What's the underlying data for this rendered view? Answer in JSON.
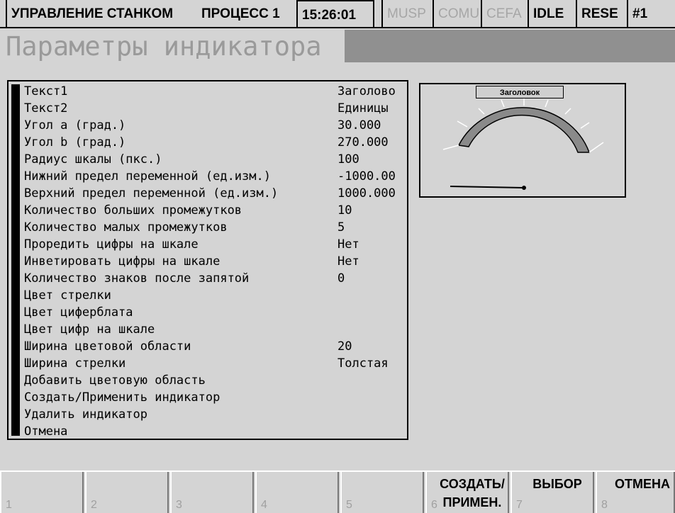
{
  "status_bar": {
    "machine_control": "УПРАВЛЕНИЕ СТАНКОМ",
    "process": "ПРОЦЕСС 1",
    "time": "15:26:01",
    "musp": "MUSP",
    "comu": "COMU",
    "cefa": "CEFA",
    "idle": "IDLE",
    "rese": "RESE",
    "channel": "#1"
  },
  "page_title": "Параметры индикатора",
  "params": [
    {
      "label": "Текст1",
      "value": "Заголово"
    },
    {
      "label": "Текст2",
      "value": "Единицы"
    },
    {
      "label": "Угол a (град.)",
      "value": "30.000"
    },
    {
      "label": "Угол b (град.)",
      "value": "270.000"
    },
    {
      "label": "Радиус шкалы (пкс.)",
      "value": "100"
    },
    {
      "label": "Нижний предел переменной (ед.изм.)",
      "value": "-1000.00"
    },
    {
      "label": "Верхний предел переменной (ед.изм.)",
      "value": "1000.000"
    },
    {
      "label": "Количество больших промежутков",
      "value": "10"
    },
    {
      "label": "Количество малых промежутков",
      "value": "5"
    },
    {
      "label": "Проредить цифры на шкале",
      "value": "Нет"
    },
    {
      "label": "Инветировать цифры на шкале",
      "value": "Нет"
    },
    {
      "label": "Количество знаков после запятой",
      "value": "0"
    },
    {
      "label": "Цвет стрелки",
      "swatch_color": "#000000"
    },
    {
      "label": "Цвет циферблата",
      "swatch_color": "#000000"
    },
    {
      "label": "Цвет цифр на шкале",
      "swatch_color": "#000000"
    },
    {
      "label": "Ширина цветовой области",
      "value": "20"
    },
    {
      "label": "Ширина стрелки",
      "value": "Толстая"
    },
    {
      "label": "Добавить цветовую область",
      "value": ""
    },
    {
      "label": "Создать/Применить индикатор",
      "value": ""
    },
    {
      "label": "Удалить индикатор",
      "value": ""
    },
    {
      "label": "Отмена",
      "value": ""
    }
  ],
  "gauge_preview": {
    "title": "Заголовок",
    "arc_color": "#8a8a8a",
    "needle_color": "#000000"
  },
  "softkeys": [
    {
      "num": "1",
      "label": ""
    },
    {
      "num": "2",
      "label": ""
    },
    {
      "num": "3",
      "label": ""
    },
    {
      "num": "4",
      "label": ""
    },
    {
      "num": "5",
      "label": ""
    },
    {
      "num": "6",
      "label": "СОЗДАТЬ/ ПРИМЕН."
    },
    {
      "num": "7",
      "label": "ВЫБОР"
    },
    {
      "num": "8",
      "label": "ОТМЕНА"
    }
  ]
}
